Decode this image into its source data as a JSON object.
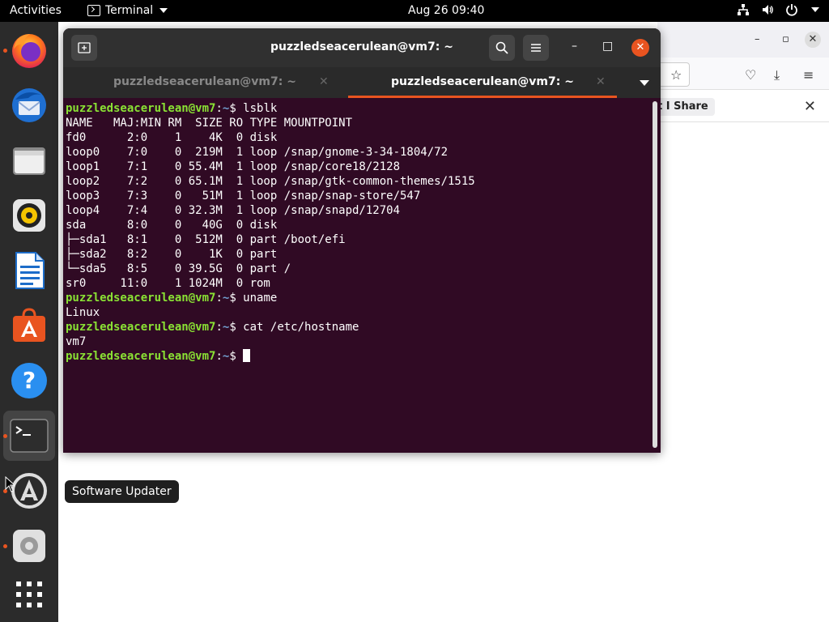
{
  "topbar": {
    "activities": "Activities",
    "app_name": "Terminal",
    "clock": "Aug 26  09:40",
    "tray_icons": [
      "network-icon",
      "volume-icon",
      "power-icon",
      "chevron-down-icon"
    ]
  },
  "dock": {
    "items": [
      {
        "name": "Firefox",
        "icon": "firefox-icon",
        "running": true
      },
      {
        "name": "Thunderbird",
        "icon": "thunderbird-icon",
        "running": false
      },
      {
        "name": "Files",
        "icon": "files-icon",
        "running": false
      },
      {
        "name": "Rhythmbox",
        "icon": "rhythmbox-icon",
        "running": false
      },
      {
        "name": "LibreOffice Writer",
        "icon": "writer-icon",
        "running": false
      },
      {
        "name": "Ubuntu Software",
        "icon": "software-icon",
        "running": false
      },
      {
        "name": "Help",
        "icon": "help-icon",
        "running": false
      },
      {
        "name": "Terminal",
        "icon": "terminal-icon",
        "running": true,
        "active": true
      },
      {
        "name": "Software Updater",
        "icon": "updater-icon",
        "running": true
      },
      {
        "name": "Settings",
        "icon": "settings-icon",
        "running": true
      },
      {
        "name": "Show Applications",
        "icon": "app-grid-icon",
        "running": false
      }
    ],
    "tooltip": "Software Updater"
  },
  "browser": {
    "notification_text": "t I Share"
  },
  "terminal": {
    "title": "puzzledseacerulean@vm7: ~",
    "tabs": [
      {
        "label": "puzzledseacerulean@vm7: ~",
        "active": false
      },
      {
        "label": "puzzledseacerulean@vm7: ~",
        "active": true
      }
    ],
    "lines": [
      {
        "user": "puzzledseacerulean@vm7",
        "path": "~",
        "cmd": "lsblk"
      },
      {
        "text": "NAME   MAJ:MIN RM  SIZE RO TYPE MOUNTPOINT"
      },
      {
        "text": "fd0      2:0    1    4K  0 disk"
      },
      {
        "text": "loop0    7:0    0  219M  1 loop /snap/gnome-3-34-1804/72"
      },
      {
        "text": "loop1    7:1    0 55.4M  1 loop /snap/core18/2128"
      },
      {
        "text": "loop2    7:2    0 65.1M  1 loop /snap/gtk-common-themes/1515"
      },
      {
        "text": "loop3    7:3    0   51M  1 loop /snap/snap-store/547"
      },
      {
        "text": "loop4    7:4    0 32.3M  1 loop /snap/snapd/12704"
      },
      {
        "text": "sda      8:0    0   40G  0 disk"
      },
      {
        "text": "├─sda1   8:1    0  512M  0 part /boot/efi"
      },
      {
        "text": "├─sda2   8:2    0    1K  0 part"
      },
      {
        "text": "└─sda5   8:5    0 39.5G  0 part /"
      },
      {
        "text": "sr0     11:0    1 1024M  0 rom"
      },
      {
        "user": "puzzledseacerulean@vm7",
        "path": "~",
        "cmd": "uname"
      },
      {
        "text": "Linux"
      },
      {
        "user": "puzzledseacerulean@vm7",
        "path": "~",
        "cmd": "cat /etc/hostname"
      },
      {
        "text": "vm7"
      },
      {
        "user": "puzzledseacerulean@vm7",
        "path": "~",
        "cmd": "",
        "cursor": true
      }
    ]
  },
  "colors": {
    "terminal_bg": "#300a24",
    "prompt_user": "#8ae234",
    "prompt_path": "#729fcf",
    "accent": "#e95420",
    "dock_bg": "#2b2b2b"
  }
}
